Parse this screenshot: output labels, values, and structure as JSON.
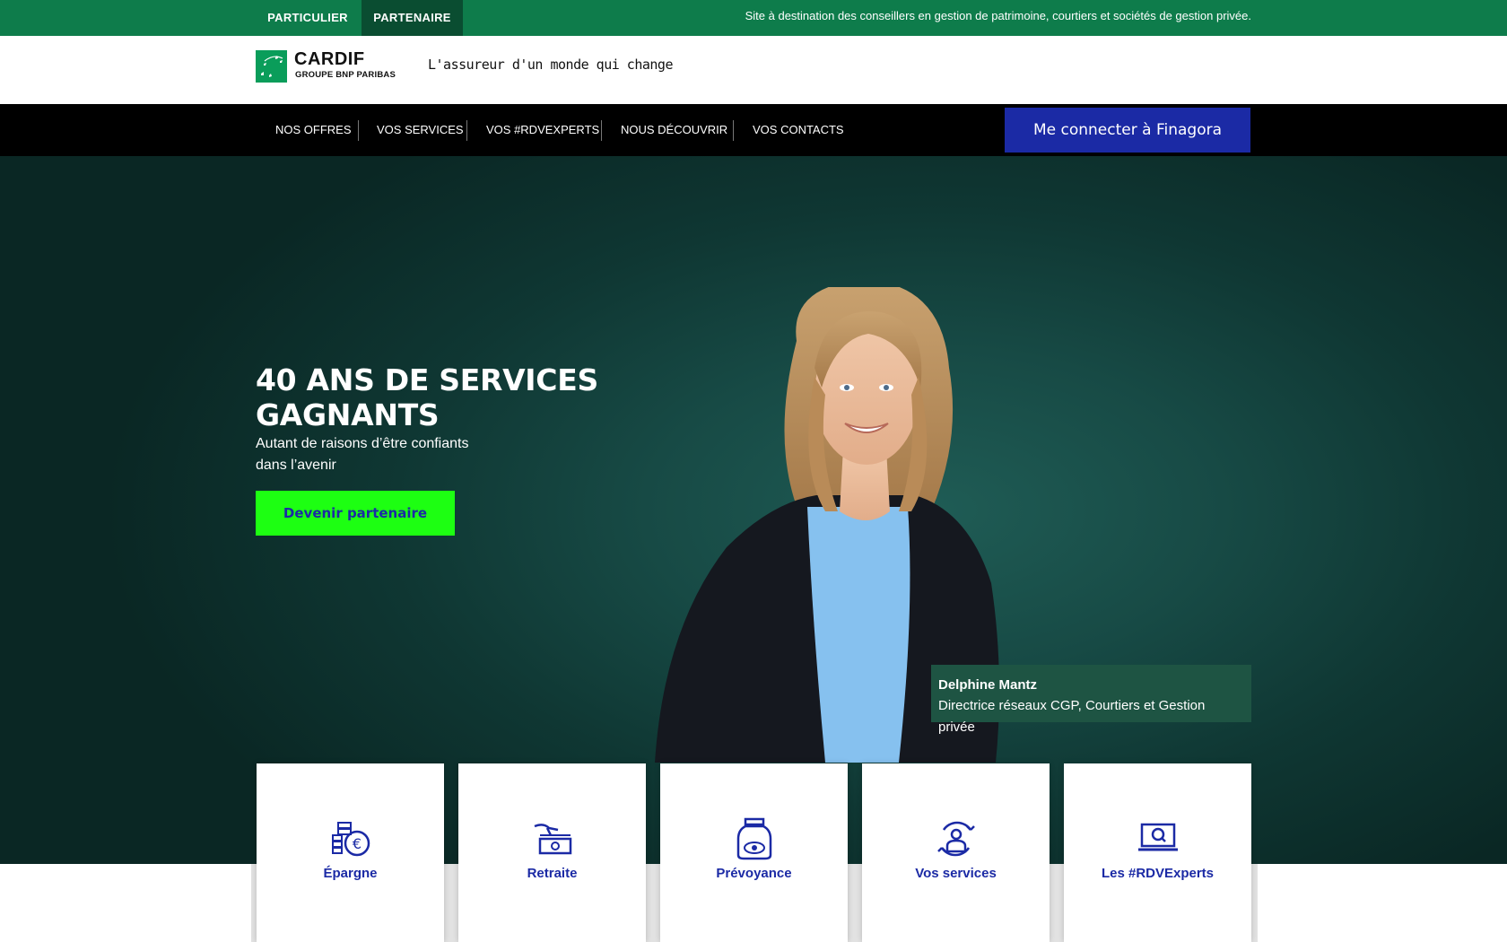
{
  "topbar": {
    "tab_particulier": "PARTICULIER",
    "tab_partenaire": "PARTENAIRE",
    "info": "Site à destination des conseillers en gestion de patrimoine, courtiers et sociétés de gestion privée."
  },
  "brand": {
    "name": "CARDIF",
    "group": "GROUPE BNP PARIBAS",
    "tagline": "L'assureur d'un monde qui change",
    "logo_icon": "stars-logo-icon"
  },
  "nav": {
    "items": [
      "NOS OFFRES",
      "VOS SERVICES",
      "VOS #RDVEXPERTS",
      "NOUS DÉCOUVRIR",
      "VOS CONTACTS"
    ],
    "connect_label": "Me connecter à Finagora"
  },
  "hero": {
    "title": "40 ANS DE SERVICES GAGNANTS",
    "subtitle": "Autant de raisons d’être confiants dans l’avenir",
    "cta": "Devenir partenaire"
  },
  "caption": {
    "name": "Delphine Mantz",
    "role": "Directrice réseaux CGP, Courtiers et Gestion privée"
  },
  "cards": [
    {
      "label": "Épargne",
      "icon": "euro-coins-icon"
    },
    {
      "label": "Retraite",
      "icon": "hand-money-icon"
    },
    {
      "label": "Prévoyance",
      "icon": "money-jar-icon"
    },
    {
      "label": "Vos services",
      "icon": "user-cycle-icon"
    },
    {
      "label": "Les #RDVExperts",
      "icon": "laptop-search-icon"
    }
  ],
  "colors": {
    "topbar_green": "#0e7c4b",
    "active_tab": "#0a4d31",
    "connect_blue": "#1b2aa5",
    "cta_green": "#1dff12",
    "hero_teal": "#174a45"
  }
}
